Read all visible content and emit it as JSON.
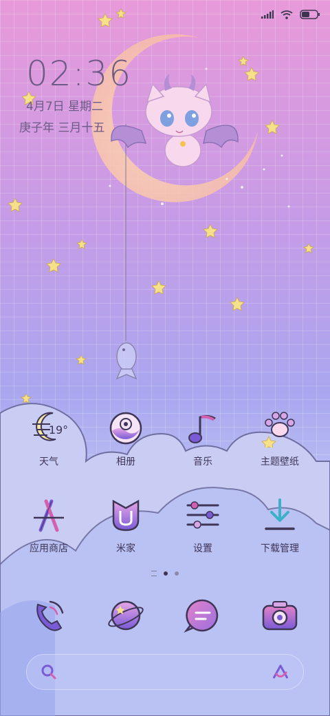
{
  "status_bar": {
    "signal_icon": "signal-bars-icon",
    "wifi_icon": "wifi-icon",
    "battery_icon": "battery-icon"
  },
  "clock": {
    "time": "02:36",
    "date": "4月7日 星期二",
    "lunar": "庚子年 三月十五"
  },
  "apps": [
    {
      "label": "天气",
      "icon": "weather-icon",
      "extra": "19°"
    },
    {
      "label": "相册",
      "icon": "gallery-icon"
    },
    {
      "label": "音乐",
      "icon": "music-icon"
    },
    {
      "label": "主题壁纸",
      "icon": "paw-theme-icon"
    },
    {
      "label": "应用商店",
      "icon": "app-store-icon"
    },
    {
      "label": "米家",
      "icon": "mijia-icon"
    },
    {
      "label": "设置",
      "icon": "settings-sliders-icon"
    },
    {
      "label": "下载管理",
      "icon": "download-icon"
    }
  ],
  "page_indicator": {
    "pages": 3,
    "active": 2
  },
  "dock": [
    {
      "icon": "phone-icon"
    },
    {
      "icon": "browser-planet-icon"
    },
    {
      "icon": "messages-icon"
    },
    {
      "icon": "camera-icon"
    }
  ],
  "search": {
    "left_icon": "search-icon",
    "right_icon": "assistant-icon"
  },
  "colors": {
    "accent_purple": "#7a5bd6",
    "accent_pink": "#d45fb0",
    "label": "#3e3557"
  }
}
